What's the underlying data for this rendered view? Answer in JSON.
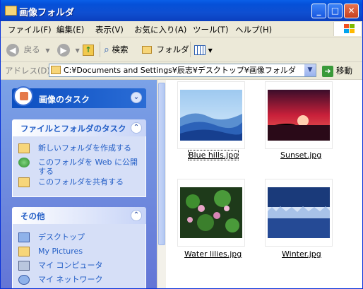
{
  "window": {
    "title": "画像フォルダ"
  },
  "menu": [
    "ファイル(F)",
    "編集(E)",
    "表示(V)",
    "お気に入り(A)",
    "ツール(T)",
    "ヘルプ(H)"
  ],
  "toolbar": {
    "back": "戻る",
    "search": "検索",
    "folders": "フォルダ"
  },
  "address": {
    "label": "アドレス(D)",
    "value": "C:¥Documents and Settings¥辰志¥デスクトップ¥画像フォルダ",
    "go": "移動"
  },
  "taskpane": {
    "special_title": "画像のタスク",
    "file_tasks": {
      "title": "ファイルとフォルダのタスク",
      "items": [
        "新しいフォルダを作成する",
        "このフォルダを Web に公開する",
        "このフォルダを共有する"
      ]
    },
    "other": {
      "title": "その他",
      "items": [
        "デスクトップ",
        "My Pictures",
        "マイ コンピュータ",
        "マイ ネットワーク"
      ]
    }
  },
  "files": [
    {
      "name": "Blue hills.jpg",
      "selected": true
    },
    {
      "name": "Sunset.jpg",
      "selected": false
    },
    {
      "name": "Water lilies.jpg",
      "selected": false
    },
    {
      "name": "Winter.jpg",
      "selected": false
    }
  ],
  "colors": {
    "title_bar": "#0a5fe8",
    "task_pane": "#7ba2e7",
    "link": "#215dc6",
    "close_button": "#e77350"
  }
}
